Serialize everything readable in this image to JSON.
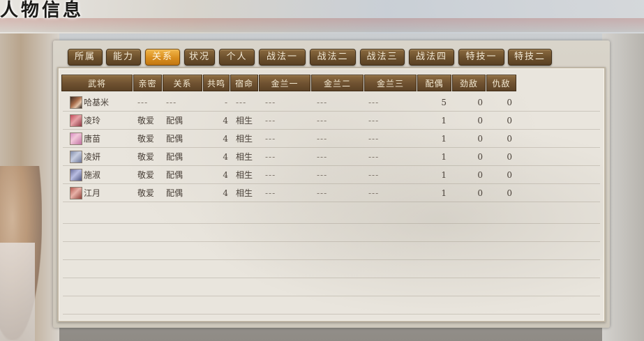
{
  "window": {
    "title": "人物信息"
  },
  "tabs": [
    {
      "label": "所属",
      "active": false
    },
    {
      "label": "能力",
      "active": false
    },
    {
      "label": "关系",
      "active": true
    },
    {
      "label": "状况",
      "active": false
    },
    {
      "label": "个人",
      "active": false
    },
    {
      "label": "战法一",
      "active": false
    },
    {
      "label": "战法二",
      "active": false
    },
    {
      "label": "战法三",
      "active": false
    },
    {
      "label": "战法四",
      "active": false
    },
    {
      "label": "特技一",
      "active": false
    },
    {
      "label": "特技二",
      "active": false
    }
  ],
  "table": {
    "columns": [
      "武将",
      "亲密",
      "关系",
      "共鸣",
      "宿命",
      "金兰一",
      "金兰二",
      "金兰三",
      "配偶",
      "劲敌",
      "仇敌"
    ],
    "rows": [
      {
        "name": "哈基米",
        "intimacy": "---",
        "relation": "---",
        "resonance": "-",
        "fate": "---",
        "sworn1": "---",
        "sworn2": "---",
        "sworn3": "---",
        "spouse": "5",
        "rival": "0",
        "enemy": "0"
      },
      {
        "name": "凌玲",
        "intimacy": "敬爱",
        "relation": "配偶",
        "resonance": "4",
        "fate": "相生",
        "sworn1": "---",
        "sworn2": "---",
        "sworn3": "---",
        "spouse": "1",
        "rival": "0",
        "enemy": "0"
      },
      {
        "name": "唐苗",
        "intimacy": "敬爱",
        "relation": "配偶",
        "resonance": "4",
        "fate": "相生",
        "sworn1": "---",
        "sworn2": "---",
        "sworn3": "---",
        "spouse": "1",
        "rival": "0",
        "enemy": "0"
      },
      {
        "name": "凌妍",
        "intimacy": "敬爱",
        "relation": "配偶",
        "resonance": "4",
        "fate": "相生",
        "sworn1": "---",
        "sworn2": "---",
        "sworn3": "---",
        "spouse": "1",
        "rival": "0",
        "enemy": "0"
      },
      {
        "name": "施淑",
        "intimacy": "敬爱",
        "relation": "配偶",
        "resonance": "4",
        "fate": "相生",
        "sworn1": "---",
        "sworn2": "---",
        "sworn3": "---",
        "spouse": "1",
        "rival": "0",
        "enemy": "0"
      },
      {
        "name": "江月",
        "intimacy": "敬爱",
        "relation": "配偶",
        "resonance": "4",
        "fate": "相生",
        "sworn1": "---",
        "sworn2": "---",
        "sworn3": "---",
        "spouse": "1",
        "rival": "0",
        "enemy": "0"
      }
    ]
  },
  "colors": {
    "tab_active": "#d98e1f",
    "tab_normal": "#6b4f2c",
    "panel_bg": "#e9e5dd"
  }
}
